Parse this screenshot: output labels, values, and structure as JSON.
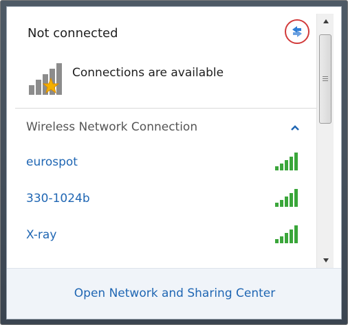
{
  "status": {
    "title": "Not connected",
    "available_text": "Connections are available",
    "refresh_icon": "network-troubleshoot-icon",
    "status_icon": "signal-bars-with-star-icon"
  },
  "section": {
    "header": "Wireless Network Connection",
    "collapse_icon": "chevron-up-icon"
  },
  "networks": [
    {
      "name": "eurospot"
    },
    {
      "name": "330-1024b"
    },
    {
      "name": "X-ray"
    }
  ],
  "footer": {
    "link": "Open Network and Sharing Center"
  },
  "colors": {
    "link": "#1f66b3",
    "signal": "#3aa63a",
    "highlight_circle": "#d23a3a"
  }
}
